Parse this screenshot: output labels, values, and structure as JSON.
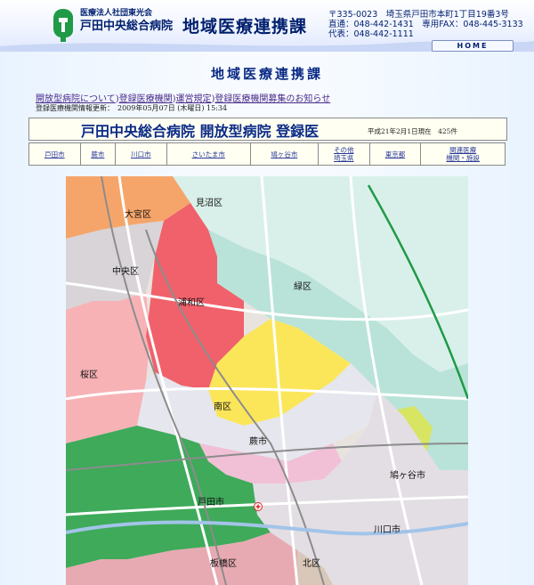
{
  "header": {
    "corp_name": "医療法人社団東光会",
    "hospital_name": "戸田中央総合病院",
    "dept_name": "地域医療連携課",
    "postal": "〒335-0023　埼玉県戸田市本町1丁目19番3号",
    "phone_direct": "直通：048-442-1431　専用FAX：048-445-3133",
    "phone_main": "代表：048-442-1111",
    "home_label": "HOME"
  },
  "page_title": "地域医療連携課",
  "breadcrumb": {
    "item1": "開放型病院について",
    "item2": "登録医療機関",
    "item3": "運営規定",
    "item4": "登録医療機関募集のお知らせ",
    "sep": ")"
  },
  "updated_text": "登録医療機関情報更新：　2009年05月07日 (木曜日) 15:34",
  "banner": {
    "title": "戸田中央総合病院 開放型病院 登録医",
    "date_note": "平成21年2月1日現在　425件"
  },
  "tabs": [
    {
      "line1": "戸田市",
      "line2": ""
    },
    {
      "line1": "蕨市",
      "line2": ""
    },
    {
      "line1": "川口市",
      "line2": ""
    },
    {
      "line1": "さいたま市",
      "line2": ""
    },
    {
      "line1": "鳩ヶ谷市",
      "line2": ""
    },
    {
      "line1": "その他",
      "line2": "埼玉県"
    },
    {
      "line1": "東京都",
      "line2": ""
    },
    {
      "line1": "関連医療",
      "line2": "機関・施設"
    }
  ],
  "map_labels": {
    "minuma": "見沼区",
    "omiya": "大宮区",
    "chuo": "中央区",
    "urawa": "浦和区",
    "midori": "緑区",
    "sakura": "桜区",
    "minami": "南区",
    "warabi": "蕨市",
    "hatogaya": "鳩ヶ谷市",
    "toda": "戸田市",
    "kawaguchi": "川口市",
    "itabashi": "板橋区",
    "kita": "北区"
  },
  "colors": {
    "navy": "#001f6e",
    "urawa": "#f0616b",
    "green": "#3eaa5a",
    "yellow": "#fbe65a",
    "midori": "#b9e3d8"
  }
}
